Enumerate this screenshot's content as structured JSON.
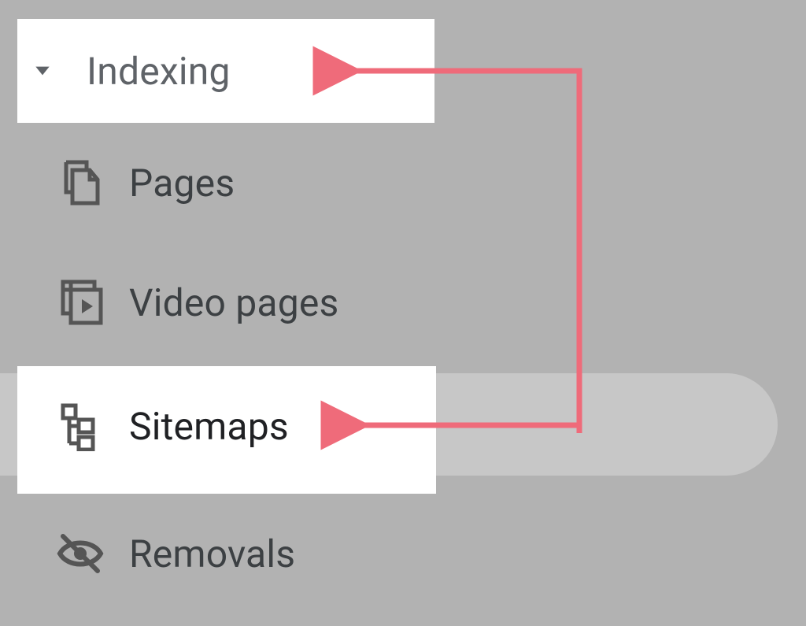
{
  "sidebar": {
    "section_label": "Indexing",
    "items": [
      {
        "label": "Pages",
        "icon": "pages-icon",
        "selected": false
      },
      {
        "label": "Video pages",
        "icon": "video-icon",
        "selected": false
      },
      {
        "label": "Sitemaps",
        "icon": "sitemap-icon",
        "selected": true
      },
      {
        "label": "Removals",
        "icon": "eye-off-icon",
        "selected": false
      }
    ]
  },
  "annotation": {
    "arrow_color": "#ef6b7a"
  },
  "colors": {
    "selected_bg": "#e7edfa",
    "text_muted": "#5f6368",
    "text": "#3c4043"
  }
}
